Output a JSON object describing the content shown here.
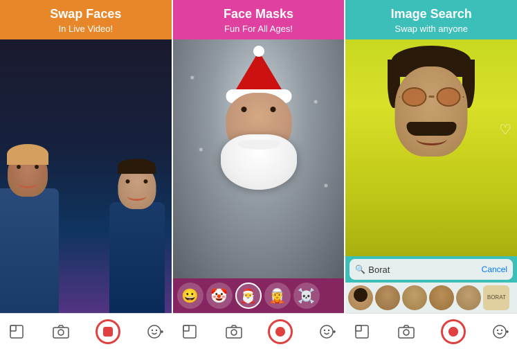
{
  "panels": [
    {
      "id": "panel-1",
      "header": {
        "title": "Swap Faces",
        "subtitle": "In Live Video!"
      },
      "toolbar": {
        "icons": [
          "gallery",
          "camera",
          "record-stop",
          "emoji-plus"
        ]
      }
    },
    {
      "id": "panel-2",
      "header": {
        "title": "Face Masks",
        "subtitle": "Fun For All Ages!"
      },
      "masks": [
        {
          "emoji": "😀",
          "label": "emoji"
        },
        {
          "emoji": "🤡",
          "label": "clown"
        },
        {
          "emoji": "🎅",
          "label": "santa",
          "selected": true
        },
        {
          "emoji": "🧝",
          "label": "elf"
        },
        {
          "emoji": "☠️",
          "label": "skull"
        }
      ],
      "toolbar": {
        "icons": [
          "gallery",
          "camera",
          "record",
          "emoji-plus"
        ]
      }
    },
    {
      "id": "panel-3",
      "header": {
        "title": "Image Search",
        "subtitle": "Swap with anyone"
      },
      "search": {
        "placeholder": "Search",
        "value": "Borat",
        "cancel_label": "Cancel"
      },
      "results": [
        {
          "label": "borat-1"
        },
        {
          "label": "borat-2"
        },
        {
          "label": "borat-3"
        },
        {
          "label": "borat-4"
        },
        {
          "label": "borat-5"
        },
        {
          "label": "borat-card"
        }
      ],
      "toolbar": {
        "icons": [
          "gallery",
          "camera",
          "record",
          "emoji-plus"
        ]
      }
    }
  ],
  "colors": {
    "panel1_bg": "#e8872a",
    "panel2_bg": "#e040a0",
    "panel3_bg": "#3cbfb8",
    "record_color": "#e04040",
    "link_color": "#007aff"
  }
}
